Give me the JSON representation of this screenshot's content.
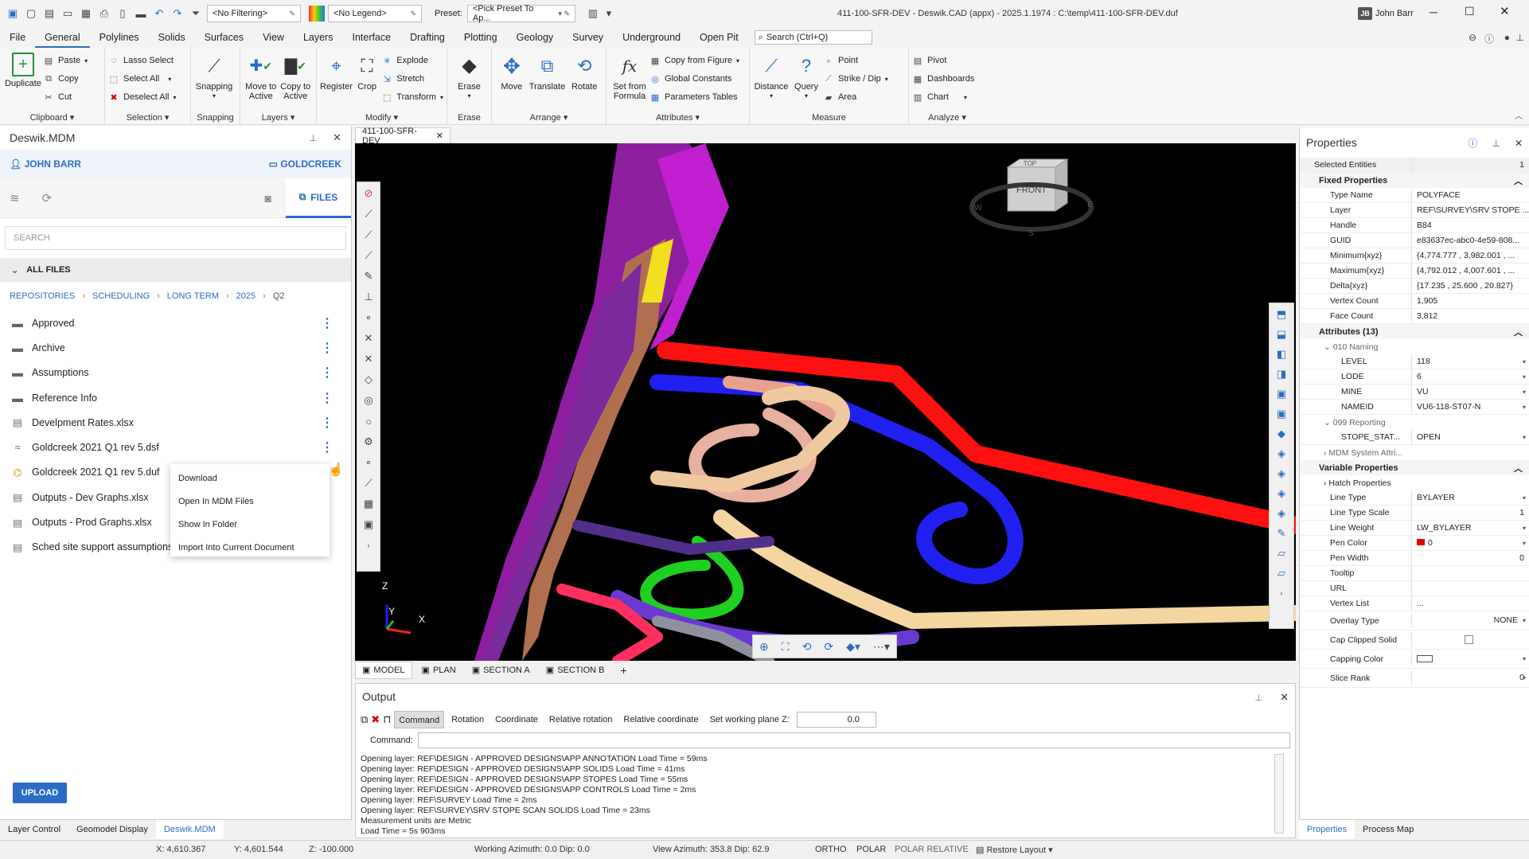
{
  "titlebar": {
    "filter": "<No Filtering>",
    "legend": "<No Legend>",
    "preset_label": "Preset:",
    "preset": "<Pick Preset To Ap...",
    "title": "411-100-SFR-DEV - Deswik.CAD (appx) - 2025.1.1974 : C:\\temp\\411-100-SFR-DEV.duf",
    "user_initials": "JB",
    "user": "John Barr"
  },
  "menu": {
    "tabs": [
      "File",
      "General",
      "Polylines",
      "Solids",
      "Surfaces",
      "View",
      "Layers",
      "Interface",
      "Drafting",
      "Plotting",
      "Geology",
      "Survey",
      "Underground",
      "Open Pit"
    ],
    "search": "Search (Ctrl+Q)"
  },
  "ribbon": {
    "clipboard": {
      "label": "Clipboard",
      "duplicate": "Duplicate",
      "paste": "Paste",
      "copy": "Copy",
      "cut": "Cut"
    },
    "selection": {
      "label": "Selection",
      "lasso": "Lasso Select",
      "select_all": "Select All",
      "deselect_all": "Deselect All"
    },
    "snapping": {
      "label": "Snapping",
      "snapping": "Snapping"
    },
    "layers": {
      "label": "Layers",
      "move": "Move to Active",
      "copy": "Copy to Active"
    },
    "modify": {
      "label": "Modify",
      "register": "Register",
      "crop": "Crop",
      "explode": "Explode",
      "stretch": "Stretch",
      "transform": "Transform"
    },
    "erase": {
      "label": "Erase",
      "erase": "Erase"
    },
    "arrange": {
      "label": "Arrange",
      "move": "Move",
      "translate": "Translate",
      "rotate": "Rotate"
    },
    "attributes": {
      "label": "Attributes",
      "set_formula": "Set from Formula",
      "copy_figure": "Copy from Figure",
      "global_constants": "Global Constants",
      "parameters_tables": "Parameters Tables"
    },
    "measure": {
      "label": "Measure",
      "distance": "Distance",
      "query": "Query",
      "point": "Point",
      "strike_dip": "Strike / Dip",
      "area": "Area"
    },
    "analyze": {
      "label": "Analyze",
      "pivot": "Pivot",
      "dashboards": "Dashboards",
      "chart": "Chart"
    }
  },
  "left": {
    "title": "Deswik.MDM",
    "user": "JOHN BARR",
    "site": "GOLDCREEK",
    "files_tab": "FILES",
    "search_placeholder": "SEARCH",
    "all_files": "ALL FILES",
    "breadcrumb": [
      "REPOSITORIES",
      "SCHEDULING",
      "LONG TERM",
      "2025",
      "Q2"
    ],
    "files": [
      {
        "name": "Approved",
        "type": "folder"
      },
      {
        "name": "Archive",
        "type": "folder"
      },
      {
        "name": "Assumptions",
        "type": "folder"
      },
      {
        "name": "Reference Info",
        "type": "folder"
      },
      {
        "name": "Develpment Rates.xlsx",
        "type": "file"
      },
      {
        "name": "Goldcreek 2021 Q1 rev 5.dsf",
        "type": "dsf"
      },
      {
        "name": "Goldcreek 2021 Q1 rev 5.duf",
        "type": "duf"
      },
      {
        "name": "Outputs - Dev Graphs.xlsx",
        "type": "file"
      },
      {
        "name": "Outputs - Prod Graphs.xlsx",
        "type": "file"
      },
      {
        "name": "Sched site support assumptions",
        "type": "file"
      }
    ],
    "context_menu": [
      "Download",
      "Open In MDM Files",
      "Show In Folder",
      "Import Into Current Document"
    ],
    "upload": "UPLOAD",
    "bottom_tabs": [
      "Layer Control",
      "Geomodel Display",
      "Deswik.MDM"
    ]
  },
  "viewport": {
    "doc_tab": "411-100-SFR-DEV",
    "view_cube_top": "TOP",
    "view_cube_front": "FRONT",
    "compass": [
      "W",
      "E",
      "S"
    ],
    "axes": [
      "Z",
      "Y",
      "X"
    ],
    "view_tabs": [
      "MODEL",
      "PLAN",
      "SECTION A",
      "SECTION B"
    ]
  },
  "output": {
    "title": "Output",
    "buttons": [
      "Command",
      "Rotation",
      "Coordinate",
      "Relative rotation",
      "Relative coordinate"
    ],
    "working_plane_label": "Set working plane Z:",
    "working_plane": "0.0",
    "command_label": "Command:",
    "log": [
      "Opening layer: REF\\DESIGN - APPROVED DESIGNS\\APP ANNOTATION  Load Time = 59ms",
      "Opening layer: REF\\DESIGN - APPROVED DESIGNS\\APP SOLIDS  Load Time = 41ms",
      "Opening layer: REF\\DESIGN - APPROVED DESIGNS\\APP STOPES  Load Time = 55ms",
      "Opening layer: REF\\DESIGN - APPROVED DESIGNS\\APP CONTROLS  Load Time = 2ms",
      "Opening layer: REF\\SURVEY  Load Time = 2ms",
      "Opening layer: REF\\SURVEY\\SRV STOPE SCAN SOLIDS  Load Time = 23ms",
      "Measurement units are Metric",
      "Load Time = 5s 903ms"
    ]
  },
  "properties": {
    "title": "Properties",
    "selected_label": "Selected Entities",
    "selected_count": "1",
    "fixed_label": "Fixed Properties",
    "fixed": [
      [
        "Type Name",
        "POLYFACE"
      ],
      [
        "Layer",
        "REF\\SURVEY\\SRV STOPE ..."
      ],
      [
        "Handle",
        "B84"
      ],
      [
        "GUID",
        "e83637ec-abc0-4e59-808..."
      ],
      [
        "Minimum{xyz}",
        "{4,774.777 , 3,982.001 , ..."
      ],
      [
        "Maximum{xyz}",
        "{4,792.012 , 4,007.601 , ..."
      ],
      [
        "Delta{xyz}",
        "{17.235 , 25.600 , 20.827}"
      ],
      [
        "Vertex Count",
        "1,905"
      ],
      [
        "Face Count",
        "3,812"
      ]
    ],
    "attributes_label": "Attributes (13)",
    "naming_label": "010 Naming",
    "naming": [
      [
        "LEVEL",
        "118"
      ],
      [
        "LODE",
        "6"
      ],
      [
        "MINE",
        "VU"
      ],
      [
        "NAMEID",
        "VU6-118-ST07-N"
      ]
    ],
    "reporting_label": "099 Reporting",
    "reporting": [
      [
        "STOPE_STAT...",
        "OPEN"
      ]
    ],
    "mdm_label": "MDM System Attri...",
    "variable_label": "Variable Properties",
    "hatch_label": "Hatch Properties",
    "variable": [
      [
        "Line Type",
        "BYLAYER"
      ],
      [
        "Line Type Scale",
        "1"
      ],
      [
        "Line Weight",
        "LW_BYLAYER"
      ],
      [
        "Pen Color",
        "0"
      ],
      [
        "Pen Width",
        "0"
      ],
      [
        "Tooltip",
        ""
      ],
      [
        "URL",
        ""
      ],
      [
        "Vertex List",
        "..."
      ],
      [
        "Overlay Type",
        "NONE"
      ],
      [
        "Cap Clipped Solid",
        ""
      ],
      [
        "Capping Color",
        ""
      ],
      [
        "Slice Rank",
        "0"
      ]
    ],
    "pen_color": "#e00000",
    "tabs": [
      "Properties",
      "Process Map"
    ]
  },
  "status": {
    "x": "X: 4,610.367",
    "y": "Y: 4,601.544",
    "z": "Z: -100.000",
    "azimuth": "Working Azimuth: 0.0 Dip: 0.0",
    "view": "View Azimuth: 353.8 Dip: 62.9",
    "ortho": "ORTHO",
    "polar": "POLAR",
    "polar_rel": "POLAR RELATIVE",
    "restore": "Restore Layout"
  }
}
